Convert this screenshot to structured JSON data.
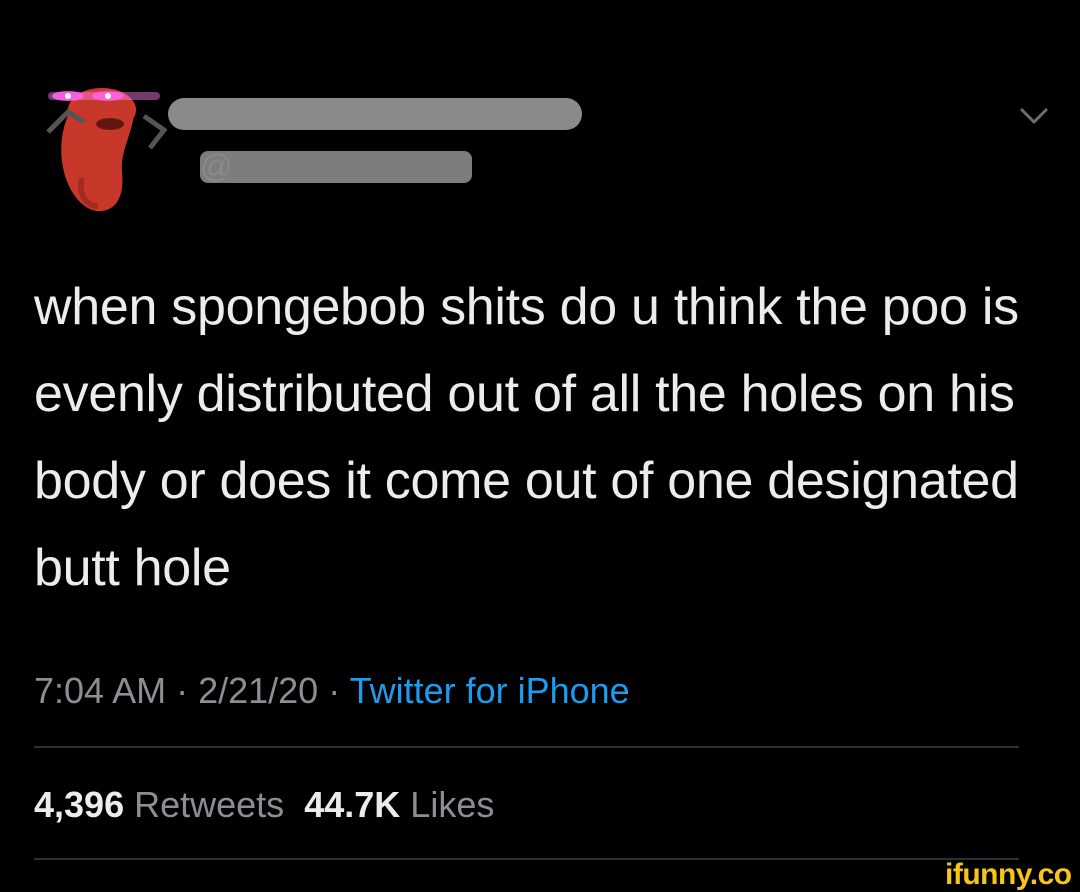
{
  "tweet": {
    "text": "when spongebob shits do u think the poo is evenly distributed out of all the holes on his body or does it come out of one designated butt hole",
    "time": "7:04 AM",
    "date": "2/21/20",
    "separator": " · ",
    "source": "Twitter for iPhone",
    "retweets_count": "4,396",
    "retweets_label": "Retweets",
    "likes_count": "44.7K",
    "likes_label": "Likes"
  },
  "header": {
    "handle_at": "@"
  },
  "watermark": {
    "text": "ifunny.co"
  },
  "colors": {
    "background": "#000000",
    "text": "#ececec",
    "muted": "#8b8f95",
    "link": "#1d9bf0",
    "watermark": "#f5c518"
  }
}
